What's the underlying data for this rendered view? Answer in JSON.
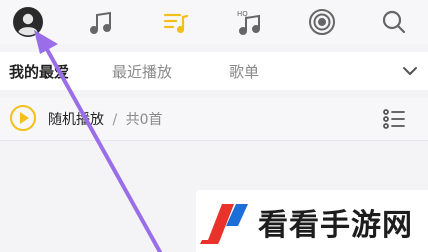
{
  "tabs": {
    "favorites": "我的最爱",
    "recent": "最近播放",
    "playlist": "歌单"
  },
  "play_row": {
    "label": "随机播放",
    "separator": "/",
    "count": "共0首"
  },
  "watermark": {
    "text": "看看手游网"
  },
  "icons": {
    "avatar": "avatar-icon",
    "music": "music-note-icon",
    "list": "music-list-icon",
    "hq": "hq-music-icon",
    "radio": "radio-icon",
    "search": "search-icon",
    "dropdown": "chevron-down-icon",
    "menu": "list-menu-icon"
  },
  "colors": {
    "accent": "#f5bf1a",
    "arrow": "#9a6ee8",
    "logo_red": "#e8322a",
    "logo_blue": "#1b6fd6"
  }
}
